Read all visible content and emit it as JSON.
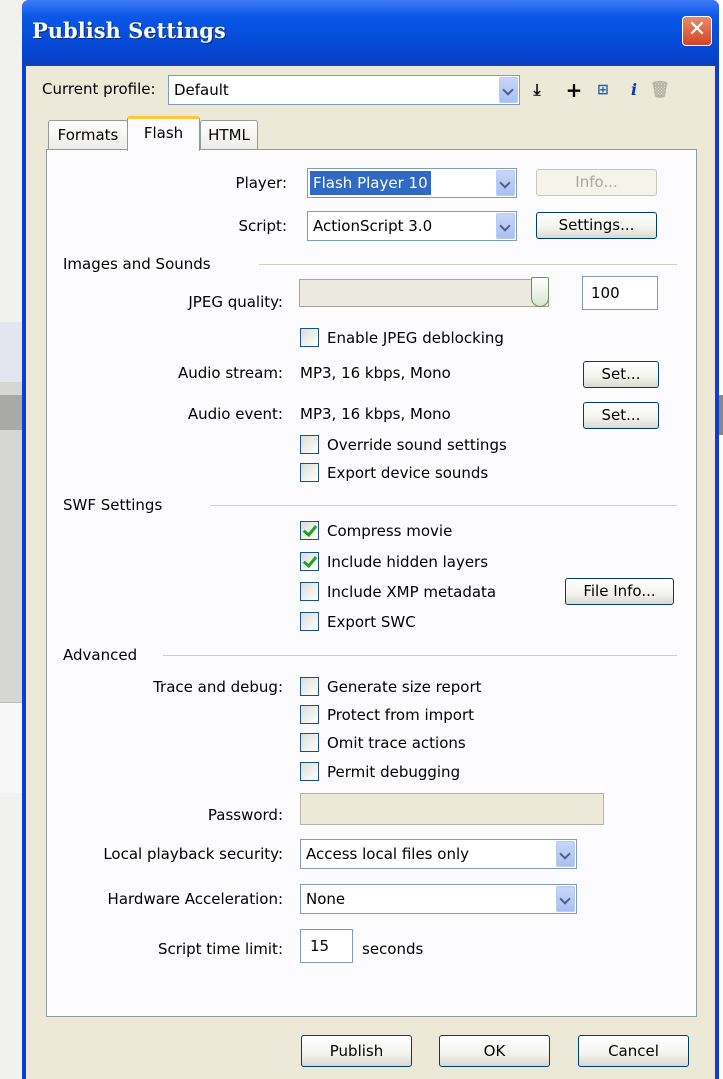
{
  "window": {
    "title": "Publish Settings",
    "close_glyph": "✕"
  },
  "profile": {
    "label": "Current profile:",
    "value": "Default",
    "icons": [
      "import-export-icon",
      "add-profile-icon",
      "duplicate-profile-icon",
      "profile-properties-icon",
      "delete-profile-icon"
    ]
  },
  "tabs": [
    {
      "label": "Formats",
      "active": false
    },
    {
      "label": "Flash",
      "active": true
    },
    {
      "label": "HTML",
      "active": false
    }
  ],
  "player": {
    "label": "Player:",
    "value": "Flash Player 10",
    "info_button": "Info..."
  },
  "script": {
    "label": "Script:",
    "value": "ActionScript 3.0",
    "settings_button": "Settings..."
  },
  "images_sounds": {
    "heading": "Images and Sounds",
    "jpeg_label": "JPEG quality:",
    "jpeg_value": "100",
    "jpeg_deblocking": {
      "label": "Enable JPEG deblocking",
      "checked": false
    },
    "audio_stream": {
      "label": "Audio stream:",
      "value": "MP3, 16 kbps, Mono",
      "button": "Set..."
    },
    "audio_event": {
      "label": "Audio event:",
      "value": "MP3, 16 kbps, Mono",
      "button": "Set..."
    },
    "override_sound": {
      "label": "Override sound settings",
      "checked": false
    },
    "export_device_sounds": {
      "label": "Export device sounds",
      "checked": false
    }
  },
  "swf": {
    "heading": "SWF Settings",
    "compress_movie": {
      "label": "Compress movie",
      "checked": true
    },
    "include_hidden_layers": {
      "label": "Include hidden layers",
      "checked": true
    },
    "include_xmp": {
      "label": "Include XMP metadata",
      "checked": false
    },
    "file_info_button": "File Info...",
    "export_swc": {
      "label": "Export SWC",
      "checked": false
    }
  },
  "advanced": {
    "heading": "Advanced",
    "trace_label": "Trace and debug:",
    "generate_size_report": {
      "label": "Generate size report",
      "checked": false
    },
    "protect_from_import": {
      "label": "Protect from import",
      "checked": false
    },
    "omit_trace_actions": {
      "label": "Omit trace actions",
      "checked": false
    },
    "permit_debugging": {
      "label": "Permit debugging",
      "checked": false
    },
    "password_label": "Password:",
    "password_value": "",
    "local_playback": {
      "label": "Local playback security:",
      "value": "Access local files only"
    },
    "hardware_accel": {
      "label": "Hardware Acceleration:",
      "value": "None"
    },
    "script_time_limit": {
      "label": "Script time limit:",
      "value": "15",
      "unit": "seconds"
    }
  },
  "footer": {
    "publish": "Publish",
    "ok": "OK",
    "cancel": "Cancel"
  }
}
